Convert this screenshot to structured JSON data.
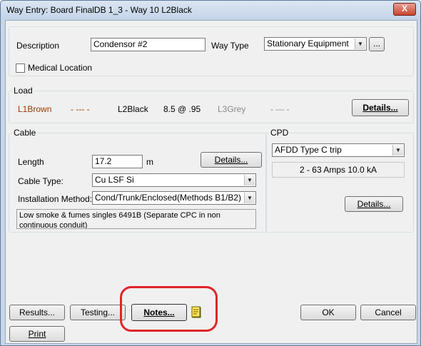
{
  "window": {
    "title": "Way Entry: Board FinalDB 1_3 - Way 10 L2Black",
    "close_glyph": "X"
  },
  "general": {
    "description_label": "Description",
    "description_value": "Condensor #2",
    "way_type_label": "Way Type",
    "way_type_value": "Stationary Equipment",
    "ellipsis_label": "...",
    "medical_location_label": "Medical Location",
    "medical_location_checked": false
  },
  "load": {
    "group_label": "Load",
    "l1_label": "L1Brown",
    "l1_value": "- --- -",
    "l2_label": "L2Black",
    "l2_value": "8.5 @ .95",
    "l3_label": "L3Grey",
    "l3_value": "- --- -",
    "details_label": "Details...",
    "l1_color": "#9b3b00",
    "l3_color": "#8a8a8a"
  },
  "cable": {
    "group_label": "Cable",
    "length_label": "Length",
    "length_value": "17.2",
    "length_unit": "m",
    "details_label": "Details...",
    "type_label": "Cable Type:",
    "type_value": "Cu LSF  Si",
    "method_label": "Installation Method:",
    "method_value": "Cond/Trunk/Enclosed(Methods B1/B2)",
    "description": "Low smoke & fumes singles 6491B (Separate CPC in non continuous conduit)"
  },
  "cpd": {
    "group_label": "CPD",
    "type_value": "AFDD Type C trip",
    "rating": "2 - 63 Amps   10.0 kA",
    "details_label": "Details..."
  },
  "footer": {
    "results_label": "Results...",
    "testing_label": "Testing...",
    "notes_label": "Notes...",
    "ok_label": "OK",
    "cancel_label": "Cancel",
    "print_label": "Print",
    "highlight_color": "#e0242a"
  },
  "icons": [
    "close-icon",
    "dropdown-arrow-icon",
    "notes-icon",
    "checkbox-icon"
  ]
}
